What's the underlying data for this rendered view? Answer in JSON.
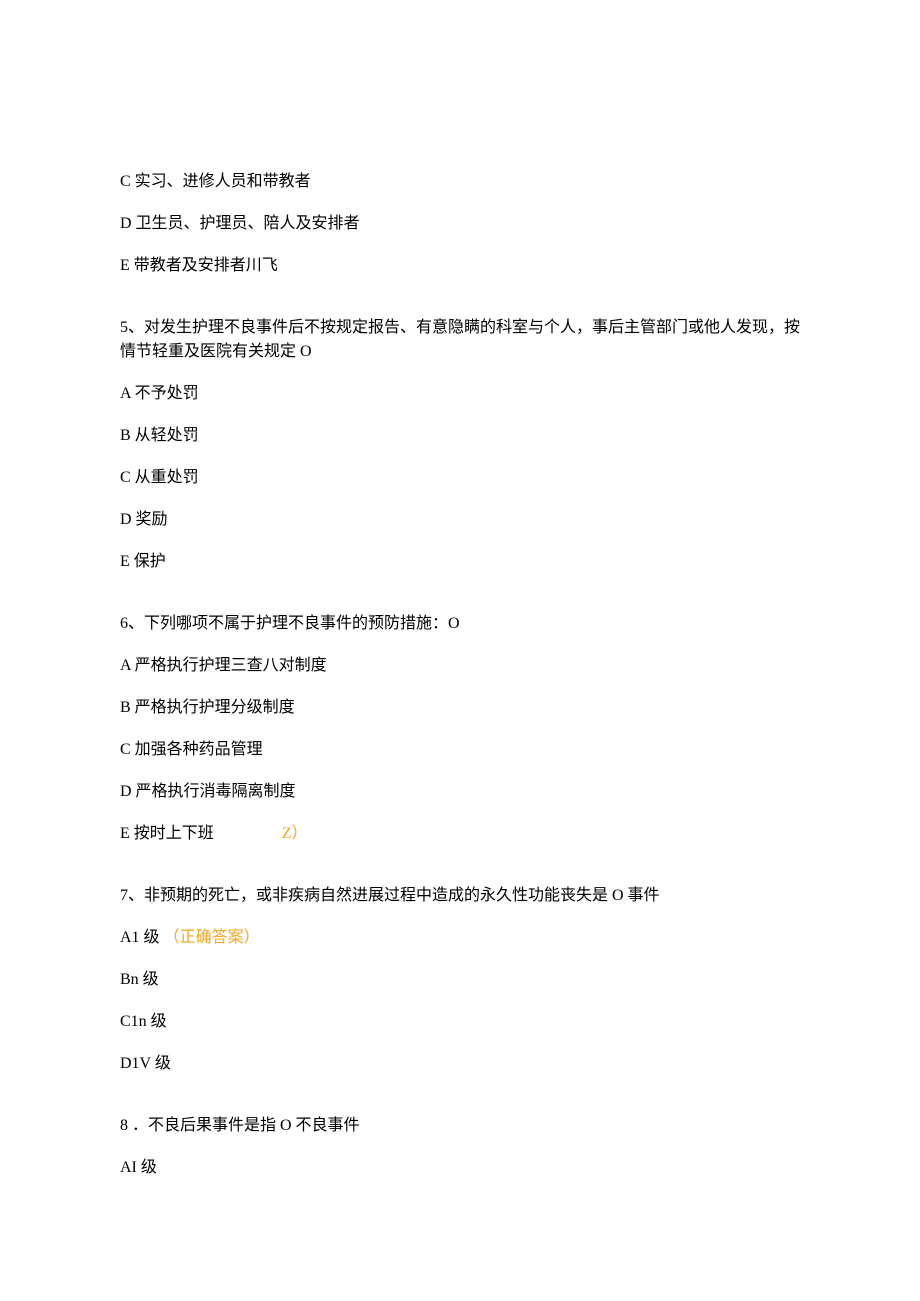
{
  "q4": {
    "optC": "C 实习、进修人员和带教者",
    "optD": "D 卫生员、护理员、陪人及安排者",
    "optE": "E 带教者及安排者川飞"
  },
  "q5": {
    "stem": "5、对发生护理不良事件后不按规定报告、有意隐瞒的科室与个人，事后主管部门或他人发现，按情节轻重及医院有关规定 O",
    "optA": "A 不予处罚",
    "optB": "B 从轻处罚",
    "optC": "C 从重处罚",
    "optD": "D 奖励",
    "optE": "E 保护"
  },
  "q6": {
    "stem": "6、下列哪项不属于护理不良事件的预防措施：O",
    "optA": "A 严格执行护理三查八对制度",
    "optB": "B 严格执行护理分级制度",
    "optC": "C 加强各种药品管理",
    "optD": "D 严格执行消毒隔离制度",
    "optE_text": "E 按时上下班",
    "optE_mark": "Z）"
  },
  "q7": {
    "stem": "7、非预期的死亡，或非疾病自然进展过程中造成的永久性功能丧失是 O 事件",
    "optA_text": "A1 级",
    "optA_mark": "（正确答案）",
    "optB": "Bn 级",
    "optC": "C1n 级",
    "optD": "D1V 级"
  },
  "q8": {
    "stem": "8 ．不良后果事件是指 O 不良事件",
    "optA": "AI 级"
  }
}
